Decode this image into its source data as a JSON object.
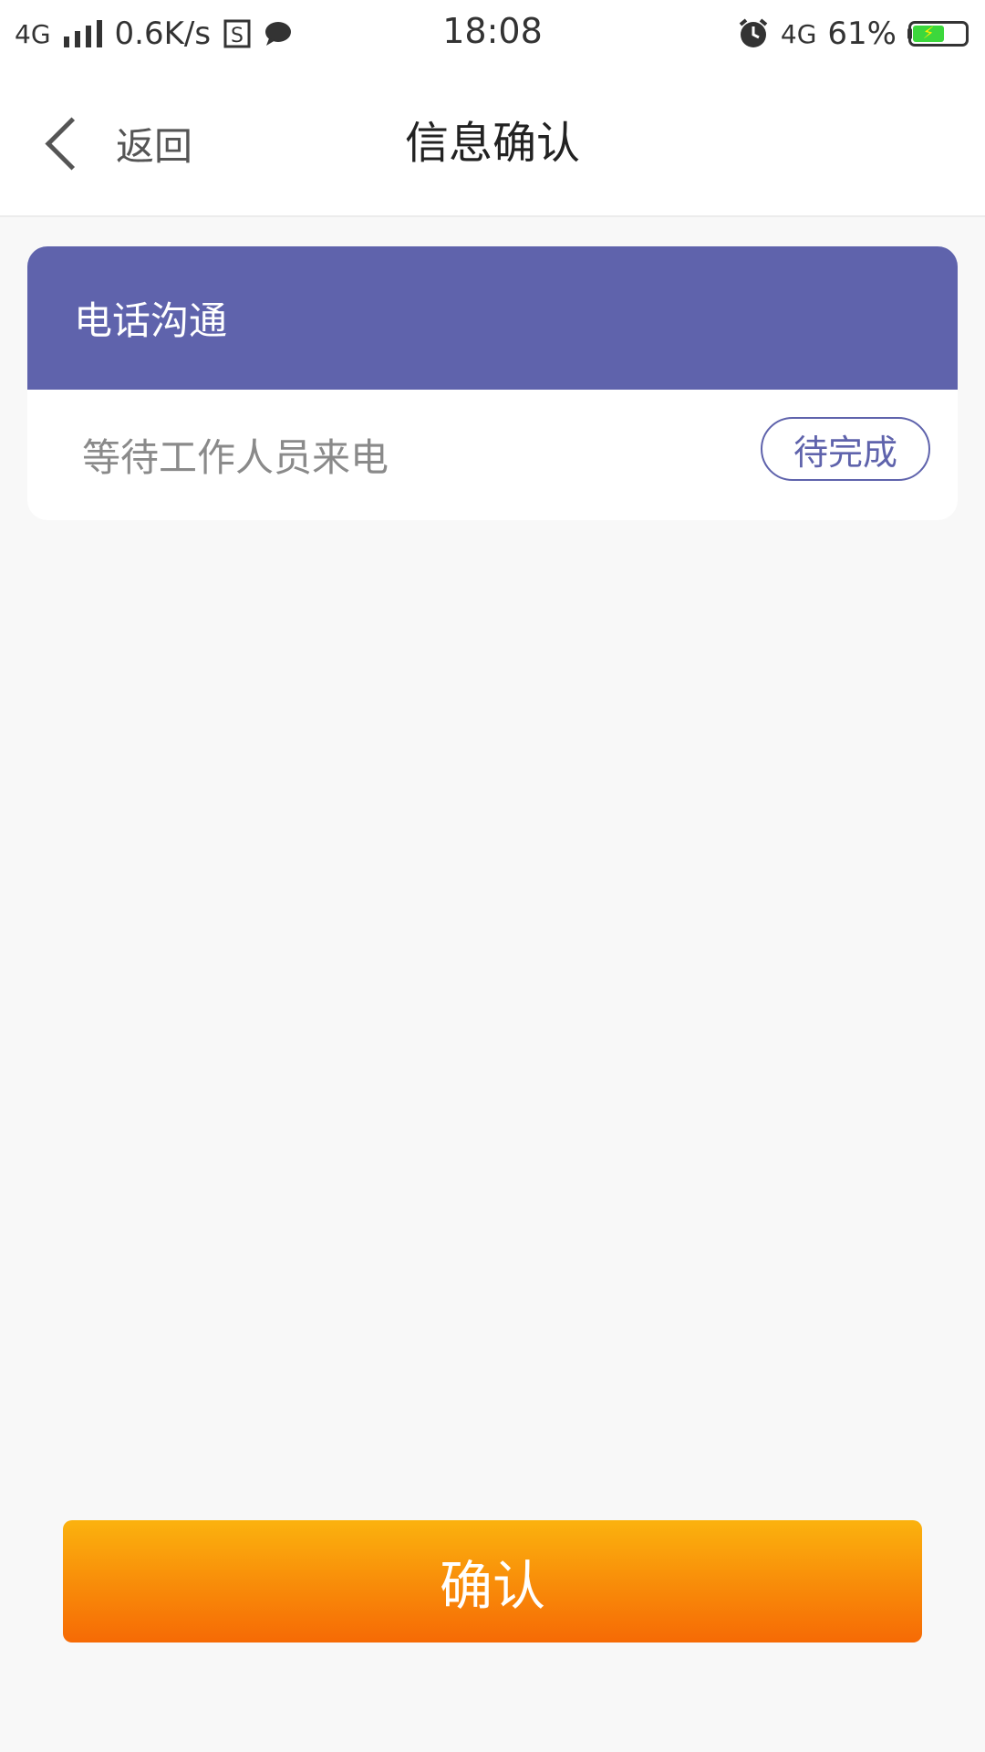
{
  "status_bar": {
    "network_left": "4G",
    "speed": "0.6K/s",
    "time": "18:08",
    "network_right": "4G",
    "battery_percent": "61%",
    "battery_level": 0.61,
    "icons": [
      "signal-icon",
      "s-app-icon",
      "chat-icon",
      "alarm-icon",
      "battery-charging-icon"
    ]
  },
  "nav": {
    "back_label": "返回",
    "title": "信息确认"
  },
  "card": {
    "header": "电话沟通",
    "row_text": "等待工作人员来电",
    "status": "待完成"
  },
  "confirm": {
    "label": "确认"
  },
  "colors": {
    "accent": "#5f63ac",
    "button_top": "#fbb20e",
    "button_bottom": "#f66a05",
    "background": "#f8f8f8"
  }
}
